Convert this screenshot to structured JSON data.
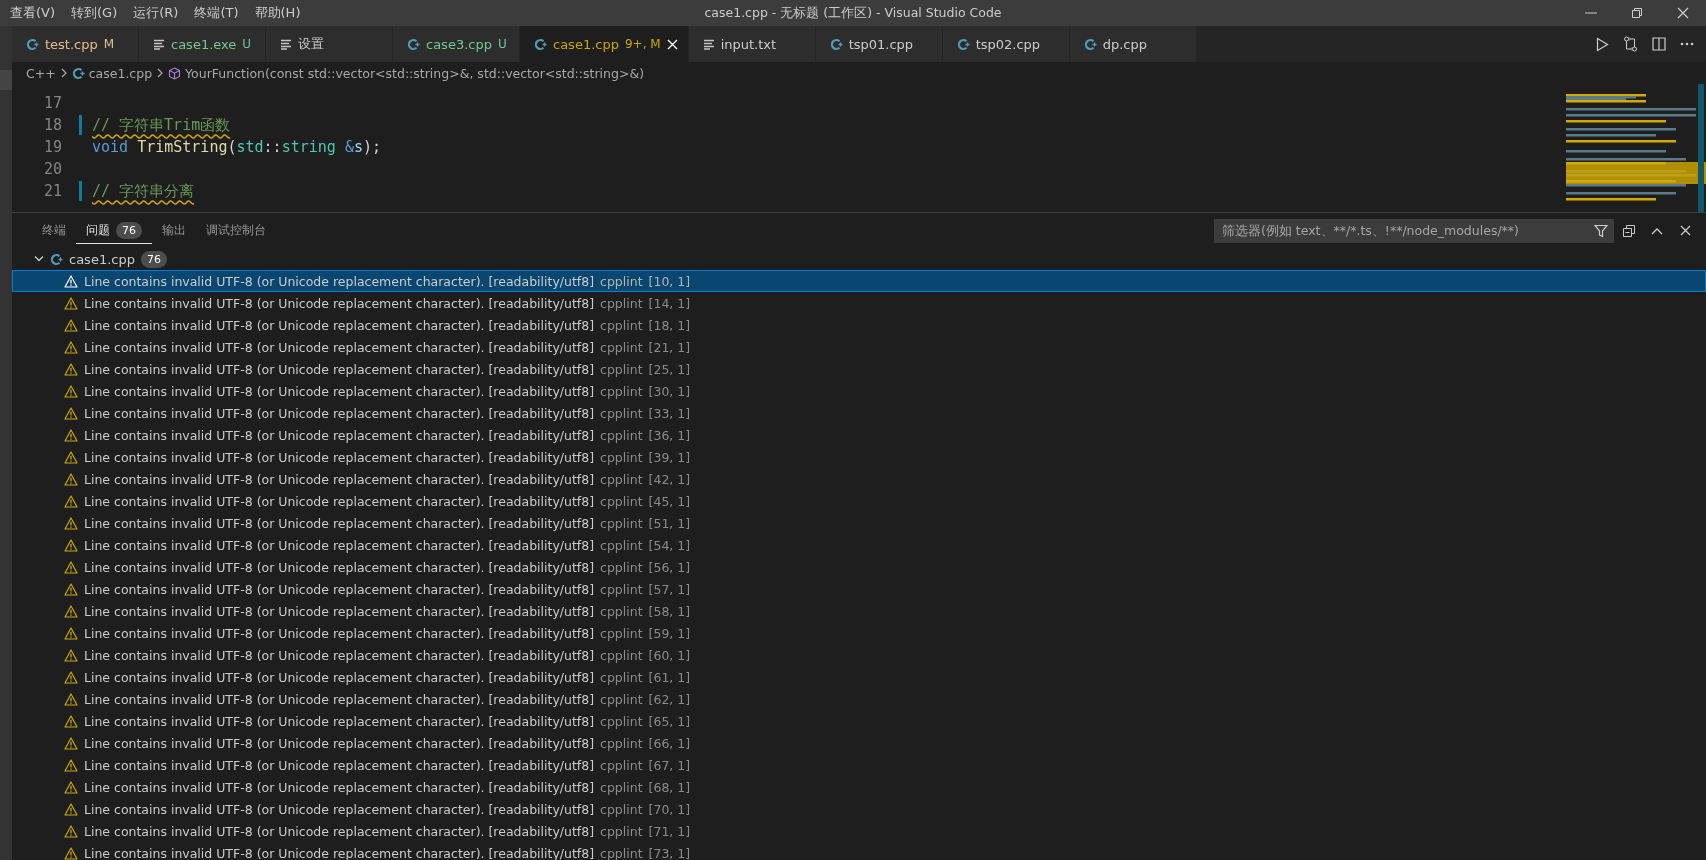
{
  "menu": [
    "查看(V)",
    "转到(G)",
    "运行(R)",
    "终端(T)",
    "帮助(H)"
  ],
  "window": {
    "title": "case1.cpp - 无标题 (工作区) - Visual Studio Code"
  },
  "tabs": [
    {
      "label": "test.cpp",
      "kind": "cpp",
      "badge": "M",
      "color": "#e2c08d",
      "selected": false
    },
    {
      "label": "case1.exe",
      "kind": "file",
      "badge": "U",
      "color": "#73c991",
      "selected": false
    },
    {
      "label": "设置",
      "kind": "file",
      "color": "#cccccc",
      "selected": false
    },
    {
      "label": "case3.cpp",
      "kind": "cpp",
      "badge": "U",
      "color": "#73c991",
      "selected": false
    },
    {
      "label": "case1.cpp",
      "kind": "cpp",
      "badge": "9+, M",
      "color": "#cca700",
      "selected": true
    },
    {
      "label": "input.txt",
      "kind": "file",
      "color": "#cccccc",
      "selected": false
    },
    {
      "label": "tsp01.cpp",
      "kind": "cpp",
      "color": "#cccccc",
      "selected": false
    },
    {
      "label": "tsp02.cpp",
      "kind": "cpp",
      "color": "#cccccc",
      "selected": false
    },
    {
      "label": "dp.cpp",
      "kind": "cpp",
      "color": "#cccccc",
      "selected": false
    }
  ],
  "breadcrumb": [
    {
      "label": "C++",
      "kind": "language"
    },
    {
      "label": "case1.cpp",
      "kind": "file"
    },
    {
      "label": "YourFunction(const std::vector<std::string>&, std::vector<std::string>&)",
      "kind": "symbol"
    }
  ],
  "editor": {
    "lines": [
      {
        "number": "17",
        "marker": false
      },
      {
        "number": "18",
        "marker": true,
        "tokens": [
          {
            "kind": "comment",
            "text": "// 字符串Trim函数",
            "warning": true
          }
        ]
      },
      {
        "number": "19",
        "marker": false,
        "tokens": [
          {
            "kind": "keyword",
            "text": "void "
          },
          {
            "kind": "function",
            "text": "TrimString"
          },
          {
            "kind": "plain",
            "text": "("
          },
          {
            "kind": "type",
            "text": "std"
          },
          {
            "kind": "plain",
            "text": "::"
          },
          {
            "kind": "type",
            "text": "string "
          },
          {
            "kind": "keyword",
            "text": "&"
          },
          {
            "kind": "variable",
            "text": "s"
          },
          {
            "kind": "plain",
            "text": ");"
          }
        ]
      },
      {
        "number": "20",
        "marker": false
      },
      {
        "number": "21",
        "marker": true,
        "tokens": [
          {
            "kind": "comment",
            "text": "// 字符串分离",
            "warning": true
          }
        ]
      }
    ]
  },
  "panel": {
    "tabs": [
      {
        "label": "终端",
        "selected": false
      },
      {
        "label": "问题",
        "badge": "76",
        "selected": true
      },
      {
        "label": "输出",
        "selected": false
      },
      {
        "label": "调试控制台",
        "selected": false
      }
    ],
    "filter": {
      "placeholder": "筛选器(例如 text、**/*.ts、!**/node_modules/**)"
    },
    "file": {
      "name": "case1.cpp",
      "count": "76",
      "expanded": true
    },
    "problems": [
      {
        "message": "Line contains invalid UTF-8 (or Unicode replacement character). [readability/utf8]",
        "source": "cpplint",
        "location": "[10, 1]",
        "selected": true
      },
      {
        "message": "Line contains invalid UTF-8 (or Unicode replacement character). [readability/utf8]",
        "source": "cpplint",
        "location": "[14, 1]",
        "selected": false
      },
      {
        "message": "Line contains invalid UTF-8 (or Unicode replacement character). [readability/utf8]",
        "source": "cpplint",
        "location": "[18, 1]",
        "selected": false
      },
      {
        "message": "Line contains invalid UTF-8 (or Unicode replacement character). [readability/utf8]",
        "source": "cpplint",
        "location": "[21, 1]",
        "selected": false
      },
      {
        "message": "Line contains invalid UTF-8 (or Unicode replacement character). [readability/utf8]",
        "source": "cpplint",
        "location": "[25, 1]",
        "selected": false
      },
      {
        "message": "Line contains invalid UTF-8 (or Unicode replacement character). [readability/utf8]",
        "source": "cpplint",
        "location": "[30, 1]",
        "selected": false
      },
      {
        "message": "Line contains invalid UTF-8 (or Unicode replacement character). [readability/utf8]",
        "source": "cpplint",
        "location": "[33, 1]",
        "selected": false
      },
      {
        "message": "Line contains invalid UTF-8 (or Unicode replacement character). [readability/utf8]",
        "source": "cpplint",
        "location": "[36, 1]",
        "selected": false
      },
      {
        "message": "Line contains invalid UTF-8 (or Unicode replacement character). [readability/utf8]",
        "source": "cpplint",
        "location": "[39, 1]",
        "selected": false
      },
      {
        "message": "Line contains invalid UTF-8 (or Unicode replacement character). [readability/utf8]",
        "source": "cpplint",
        "location": "[42, 1]",
        "selected": false
      },
      {
        "message": "Line contains invalid UTF-8 (or Unicode replacement character). [readability/utf8]",
        "source": "cpplint",
        "location": "[45, 1]",
        "selected": false
      },
      {
        "message": "Line contains invalid UTF-8 (or Unicode replacement character). [readability/utf8]",
        "source": "cpplint",
        "location": "[51, 1]",
        "selected": false
      },
      {
        "message": "Line contains invalid UTF-8 (or Unicode replacement character). [readability/utf8]",
        "source": "cpplint",
        "location": "[54, 1]",
        "selected": false
      },
      {
        "message": "Line contains invalid UTF-8 (or Unicode replacement character). [readability/utf8]",
        "source": "cpplint",
        "location": "[56, 1]",
        "selected": false
      },
      {
        "message": "Line contains invalid UTF-8 (or Unicode replacement character). [readability/utf8]",
        "source": "cpplint",
        "location": "[57, 1]",
        "selected": false
      },
      {
        "message": "Line contains invalid UTF-8 (or Unicode replacement character). [readability/utf8]",
        "source": "cpplint",
        "location": "[58, 1]",
        "selected": false
      },
      {
        "message": "Line contains invalid UTF-8 (or Unicode replacement character). [readability/utf8]",
        "source": "cpplint",
        "location": "[59, 1]",
        "selected": false
      },
      {
        "message": "Line contains invalid UTF-8 (or Unicode replacement character). [readability/utf8]",
        "source": "cpplint",
        "location": "[60, 1]",
        "selected": false
      },
      {
        "message": "Line contains invalid UTF-8 (or Unicode replacement character). [readability/utf8]",
        "source": "cpplint",
        "location": "[61, 1]",
        "selected": false
      },
      {
        "message": "Line contains invalid UTF-8 (or Unicode replacement character). [readability/utf8]",
        "source": "cpplint",
        "location": "[62, 1]",
        "selected": false
      },
      {
        "message": "Line contains invalid UTF-8 (or Unicode replacement character). [readability/utf8]",
        "source": "cpplint",
        "location": "[65, 1]",
        "selected": false
      },
      {
        "message": "Line contains invalid UTF-8 (or Unicode replacement character). [readability/utf8]",
        "source": "cpplint",
        "location": "[66, 1]",
        "selected": false
      },
      {
        "message": "Line contains invalid UTF-8 (or Unicode replacement character). [readability/utf8]",
        "source": "cpplint",
        "location": "[67, 1]",
        "selected": false
      },
      {
        "message": "Line contains invalid UTF-8 (or Unicode replacement character). [readability/utf8]",
        "source": "cpplint",
        "location": "[68, 1]",
        "selected": false
      },
      {
        "message": "Line contains invalid UTF-8 (or Unicode replacement character). [readability/utf8]",
        "source": "cpplint",
        "location": "[70, 1]",
        "selected": false
      },
      {
        "message": "Line contains invalid UTF-8 (or Unicode replacement character). [readability/utf8]",
        "source": "cpplint",
        "location": "[71, 1]",
        "selected": false
      },
      {
        "message": "Line contains invalid UTF-8 (or Unicode replacement character). [readability/utf8]",
        "source": "cpplint",
        "location": "[73, 1]",
        "selected": false
      }
    ]
  }
}
